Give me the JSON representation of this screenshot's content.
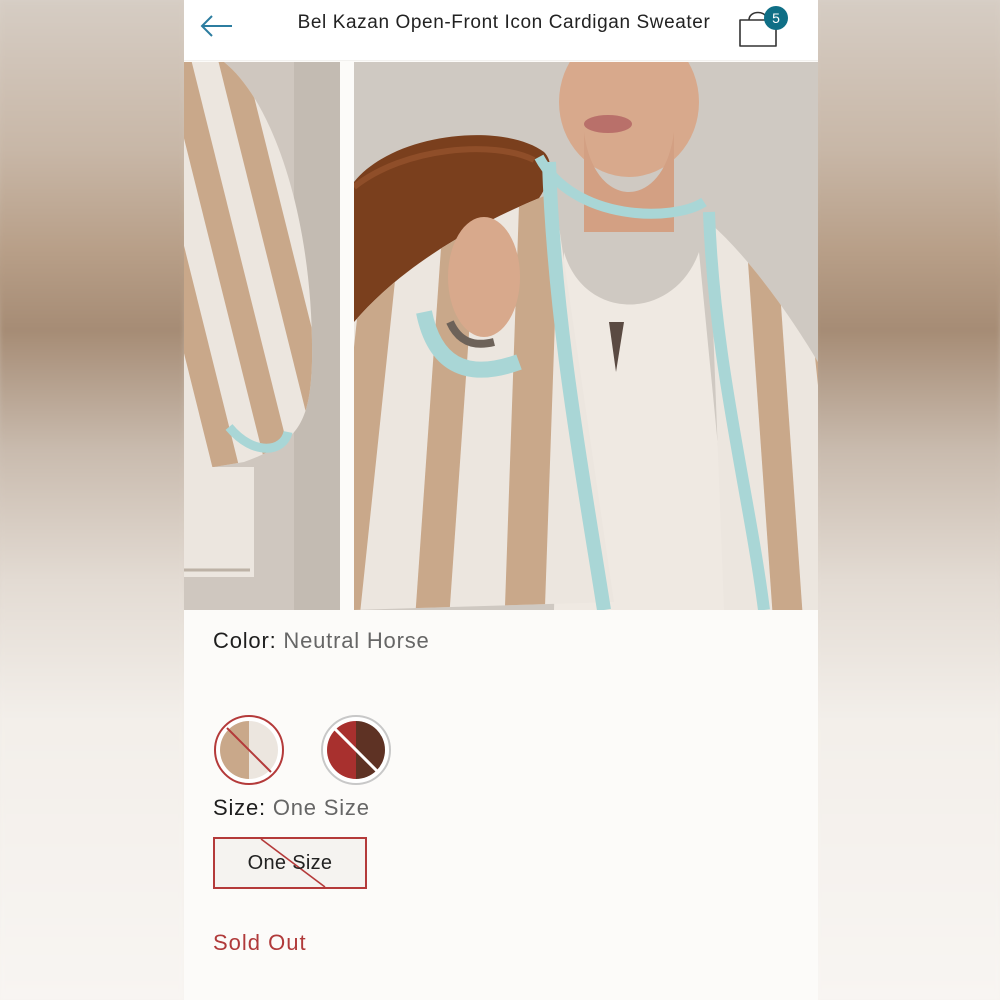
{
  "header": {
    "title": "Bel Kazan Open-Front Icon Cardigan Sweater",
    "bag_count": "5"
  },
  "icons": {
    "back": "arrow-left-icon",
    "bag": "shopping-bag-icon"
  },
  "product": {
    "color_label": "Color:",
    "color_value": "Neutral Horse",
    "size_label": "Size:",
    "size_value": "One Size",
    "size_options": [
      "One Size"
    ],
    "status": "Sold Out",
    "color_swatches": [
      {
        "colors": [
          "#c9a88a",
          "#ece6df"
        ],
        "selected": true,
        "unavailable": true
      },
      {
        "colors": [
          "#a8302e",
          "#5e3224"
        ],
        "selected": false,
        "unavailable": true
      }
    ]
  },
  "colors": {
    "accent": "#0f6f86",
    "sold_out": "#b03a3a",
    "stripe_tan": "#c9a88a",
    "stripe_cream": "#ece6df",
    "trim_mint": "#a9d6d6"
  }
}
